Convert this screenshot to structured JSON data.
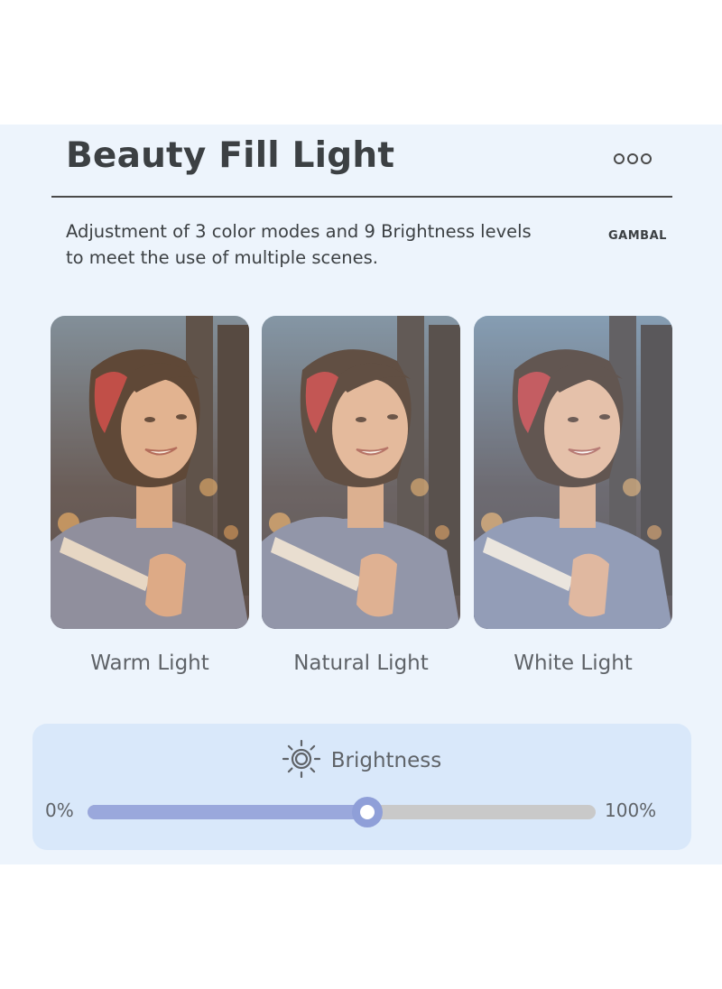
{
  "header": {
    "title": "Beauty Fill Light",
    "menu_icon": "three-dots-icon"
  },
  "description": {
    "line1": "Adjustment of 3 color modes and 9 Brightness levels",
    "line2": "to meet the use of multiple scenes.",
    "brand": "GAMBAL"
  },
  "modes": [
    {
      "label": "Warm Light",
      "tint": "#e9b98a"
    },
    {
      "label": "Natural Light",
      "tint": "#f2d3b5"
    },
    {
      "label": "White Light",
      "tint": "#f5ece6"
    }
  ],
  "brightness": {
    "label": "Brightness",
    "icon": "sun-icon",
    "min_label": "0%",
    "max_label": "100%",
    "level": 0.55
  },
  "colors": {
    "accent": "#9aa8dc",
    "panel": "#edf4fc",
    "text": "#3c4043"
  }
}
